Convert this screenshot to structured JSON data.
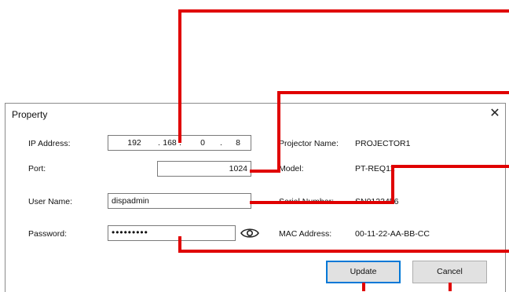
{
  "window": {
    "title": "Property",
    "close_glyph": "✕"
  },
  "fields": {
    "ip_label": "IP Address:",
    "ip": [
      "192",
      "168",
      "0",
      "8"
    ],
    "ip_sep": ".",
    "port_label": "Port:",
    "port_value": "1024",
    "user_label": "User Name:",
    "user_value": "dispadmin",
    "password_label": "Password:",
    "password_value": "•••••••••",
    "show_password_icon": "eye-icon"
  },
  "info": {
    "projector_name_label": "Projector Name:",
    "projector_name_value": "PROJECTOR1",
    "model_label": "Model:",
    "model_value": "PT-REQ12",
    "serial_label": "Serial Number:",
    "serial_value": "SN0123456",
    "mac_label": "MAC Address:",
    "mac_value": "00-11-22-AA-BB-CC"
  },
  "buttons": {
    "update": "Update",
    "cancel": "Cancel"
  },
  "colors": {
    "callout": "#e00000",
    "accent": "#0078d7"
  }
}
